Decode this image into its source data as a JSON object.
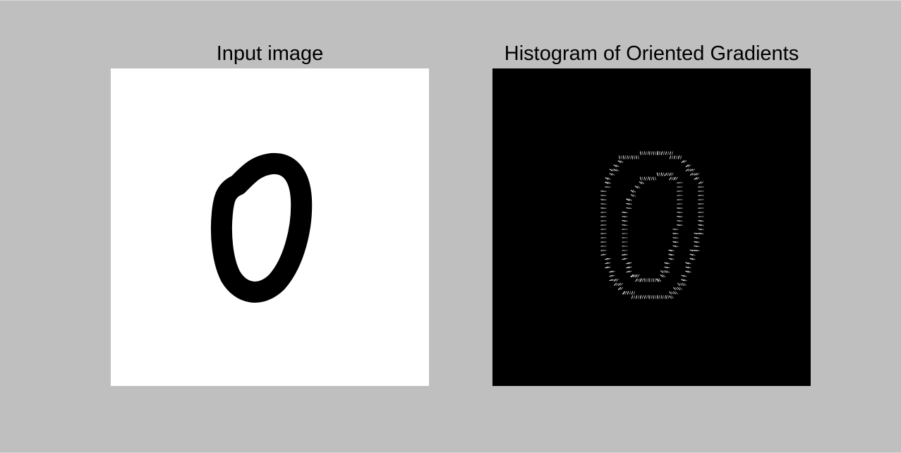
{
  "window": {
    "background_color": "#bfbfbf"
  },
  "panels": [
    {
      "title": "Input image",
      "background_color": "#ffffff",
      "content": "handwritten-digit-zero"
    },
    {
      "title": "Histogram of Oriented Gradients",
      "background_color": "#000000",
      "content": "hog-visualization-of-digit-zero"
    }
  ]
}
